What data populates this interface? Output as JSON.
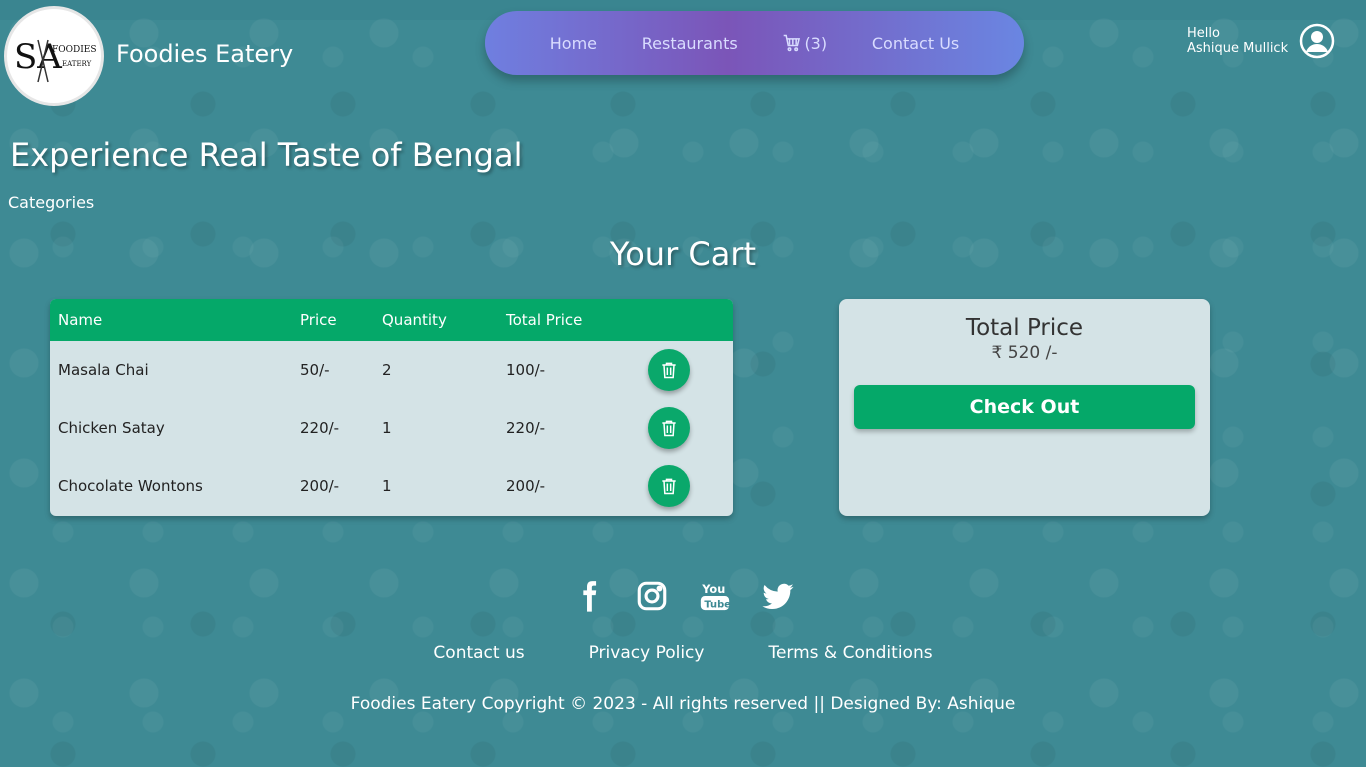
{
  "brand": {
    "logo_text_main": "SA",
    "logo_text_top": "FOODIES",
    "logo_text_bottom": "EATERY",
    "name": "Foodies Eatery"
  },
  "nav": {
    "home": "Home",
    "restaurants": "Restaurants",
    "cart_count": "(3)",
    "contact": "Contact Us"
  },
  "user": {
    "greeting": "Hello",
    "name": "Ashique Mullick"
  },
  "hero": {
    "title": "Experience Real Taste of Bengal",
    "categories": "Categories"
  },
  "cart": {
    "title": "Your Cart",
    "columns": [
      "Name",
      "Price",
      "Quantity",
      "Total Price"
    ],
    "rows": [
      {
        "name": "Masala Chai",
        "price": "50/-",
        "qty": "2",
        "total": "100/-"
      },
      {
        "name": "Chicken Satay",
        "price": "220/-",
        "qty": "1",
        "total": "220/-"
      },
      {
        "name": "Chocolate Wontons",
        "price": "200/-",
        "qty": "1",
        "total": "200/-"
      }
    ]
  },
  "summary": {
    "label": "Total Price",
    "value": "₹ 520 /-",
    "checkout": "Check Out"
  },
  "footer": {
    "social": [
      "facebook-icon",
      "instagram-icon",
      "youtube-icon",
      "twitter-icon"
    ],
    "links": [
      "Contact us",
      "Privacy Policy",
      "Terms & Conditions"
    ],
    "copyright": "Foodies Eatery Copyright © 2023 - All rights reserved || Designed By: Ashique"
  },
  "colors": {
    "background": "#3e8a94",
    "accent_green": "#05a869",
    "nav_gradient_start": "#6f7fe0",
    "nav_gradient_mid": "#7b55b8",
    "card_bg": "#d4e3e6"
  }
}
